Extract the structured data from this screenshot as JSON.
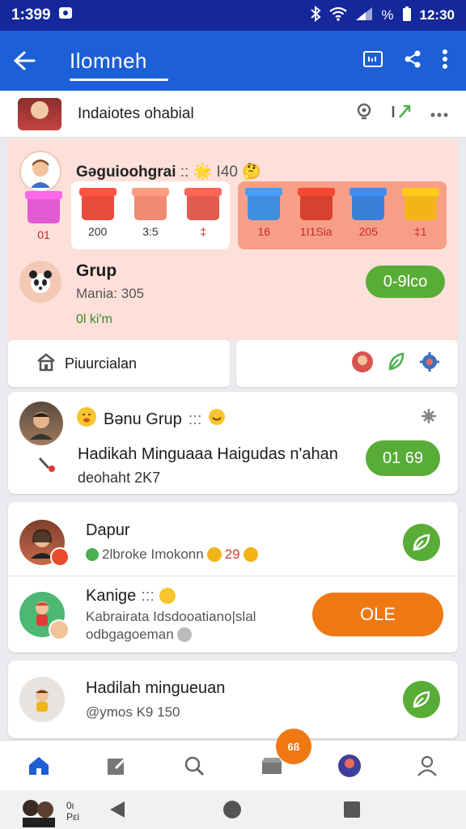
{
  "status": {
    "time": "1:399",
    "right_time": "12:30",
    "pct": "%"
  },
  "appbar": {
    "title": "Ιlomneh"
  },
  "top_item": {
    "label": "Indaiotes ohabial"
  },
  "gift_panel": {
    "heading": "Gəguioohgrai",
    "heading_extra": ":: 🌟 I40 🤔",
    "left_gifts": [
      {
        "label": "01"
      },
      {
        "label": "200"
      },
      {
        "label": "3:5"
      },
      {
        "label": "‡"
      }
    ],
    "right_gifts": [
      {
        "label": "16"
      },
      {
        "label": "1Ι1Sia"
      },
      {
        "label": "205"
      },
      {
        "label": "‡1"
      }
    ],
    "group_title": "Grup",
    "group_sub": "Mania: 305",
    "group_button": "0-9lco",
    "green_text": "0l ki'm"
  },
  "half_cards": {
    "left_label": "Ρiuurcialan"
  },
  "group_card": {
    "title": "Bənu Grup",
    "title_extra": ":::",
    "line1": "Hadikah Minguaaa Haigudas n'ahan",
    "line2": "deohaht 2K7",
    "button": "01 69"
  },
  "list": [
    {
      "title": "Dapur",
      "sub": "2lbroke Imokonn",
      "sub_num": "29"
    },
    {
      "title": "Kanige",
      "title_extra": ":::",
      "sub": "Kabrairata Idsdooatiano|slal",
      "sub2": "odbgagoeman",
      "button": "OLE"
    }
  ],
  "bottom_card": {
    "title": "Hadilah mingueuan",
    "sub": "@ymos K9 150"
  },
  "nav_badge": "6ß",
  "sys": {
    "mini1": "0ι",
    "mini2": "Ρεi"
  },
  "colors": {
    "primary": "#1c5fd6",
    "statusbar": "#14289a",
    "green": "#58ad36",
    "orange": "#f07812",
    "pink": "#fde0da",
    "salmon": "#f79f86"
  }
}
